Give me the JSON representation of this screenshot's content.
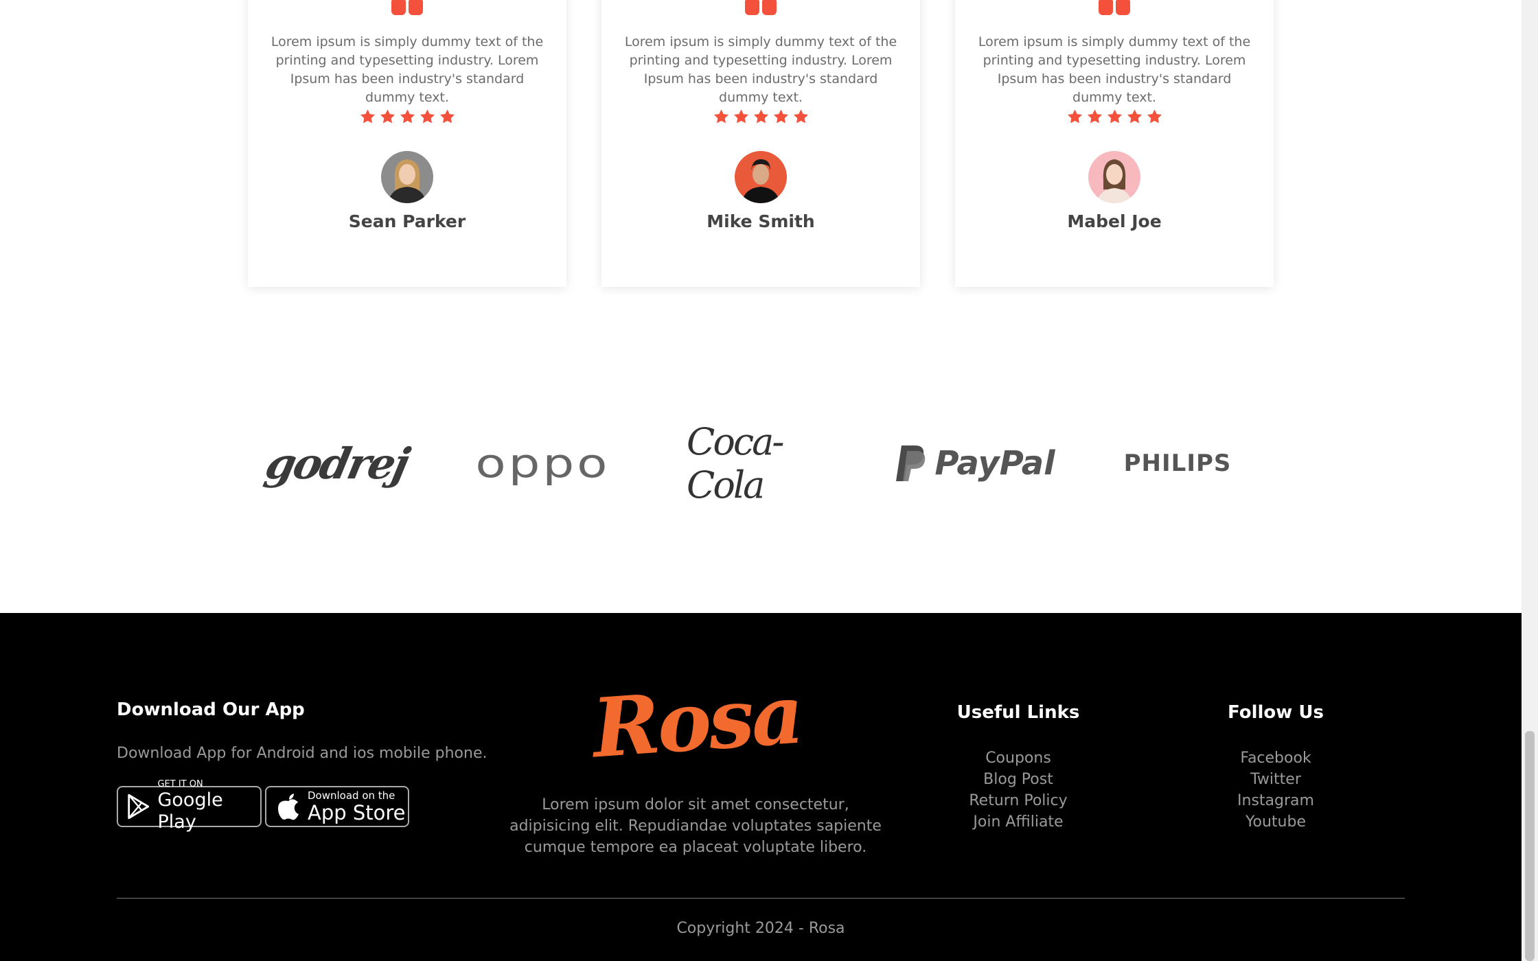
{
  "testimonials": [
    {
      "text": "Lorem ipsum is simply dummy text of the printing and typesetting industry. Lorem Ipsum has been industry's standard dummy text.",
      "rating": 5,
      "name": "Sean Parker"
    },
    {
      "text": "Lorem ipsum is simply dummy text of the printing and typesetting industry. Lorem Ipsum has been industry's standard dummy text.",
      "rating": 5,
      "name": "Mike Smith"
    },
    {
      "text": "Lorem ipsum is simply dummy text of the printing and typesetting industry. Lorem Ipsum has been industry's standard dummy text.",
      "rating": 5,
      "name": "Mabel Joe"
    }
  ],
  "brands": [
    "godrej",
    "oppo",
    "Coca-Cola",
    "PayPal",
    "PHILIPS"
  ],
  "footer": {
    "app": {
      "title": "Download Our App",
      "text": "Download App for Android and ios mobile phone.",
      "google_small": "GET IT ON",
      "google_big": "Google Play",
      "apple_small": "Download on the",
      "apple_big": "App Store"
    },
    "logo": "Rosa",
    "about": "Lorem ipsum dolor sit amet consectetur, adipisicing elit. Repudiandae voluptates sapiente cumque tempore ea placeat voluptate libero.",
    "useful_links": {
      "title": "Useful Links",
      "items": [
        "Coupons",
        "Blog Post",
        "Return Policy",
        "Join Affiliate"
      ]
    },
    "follow": {
      "title": "Follow Us",
      "items": [
        "Facebook",
        "Twitter",
        "Instagram",
        "Youtube"
      ]
    },
    "copyright": "Copyright 2024 - Rosa"
  },
  "colors": {
    "accent": "#f4513d",
    "logo": "#f26a2e",
    "footer_bg": "#000000"
  }
}
